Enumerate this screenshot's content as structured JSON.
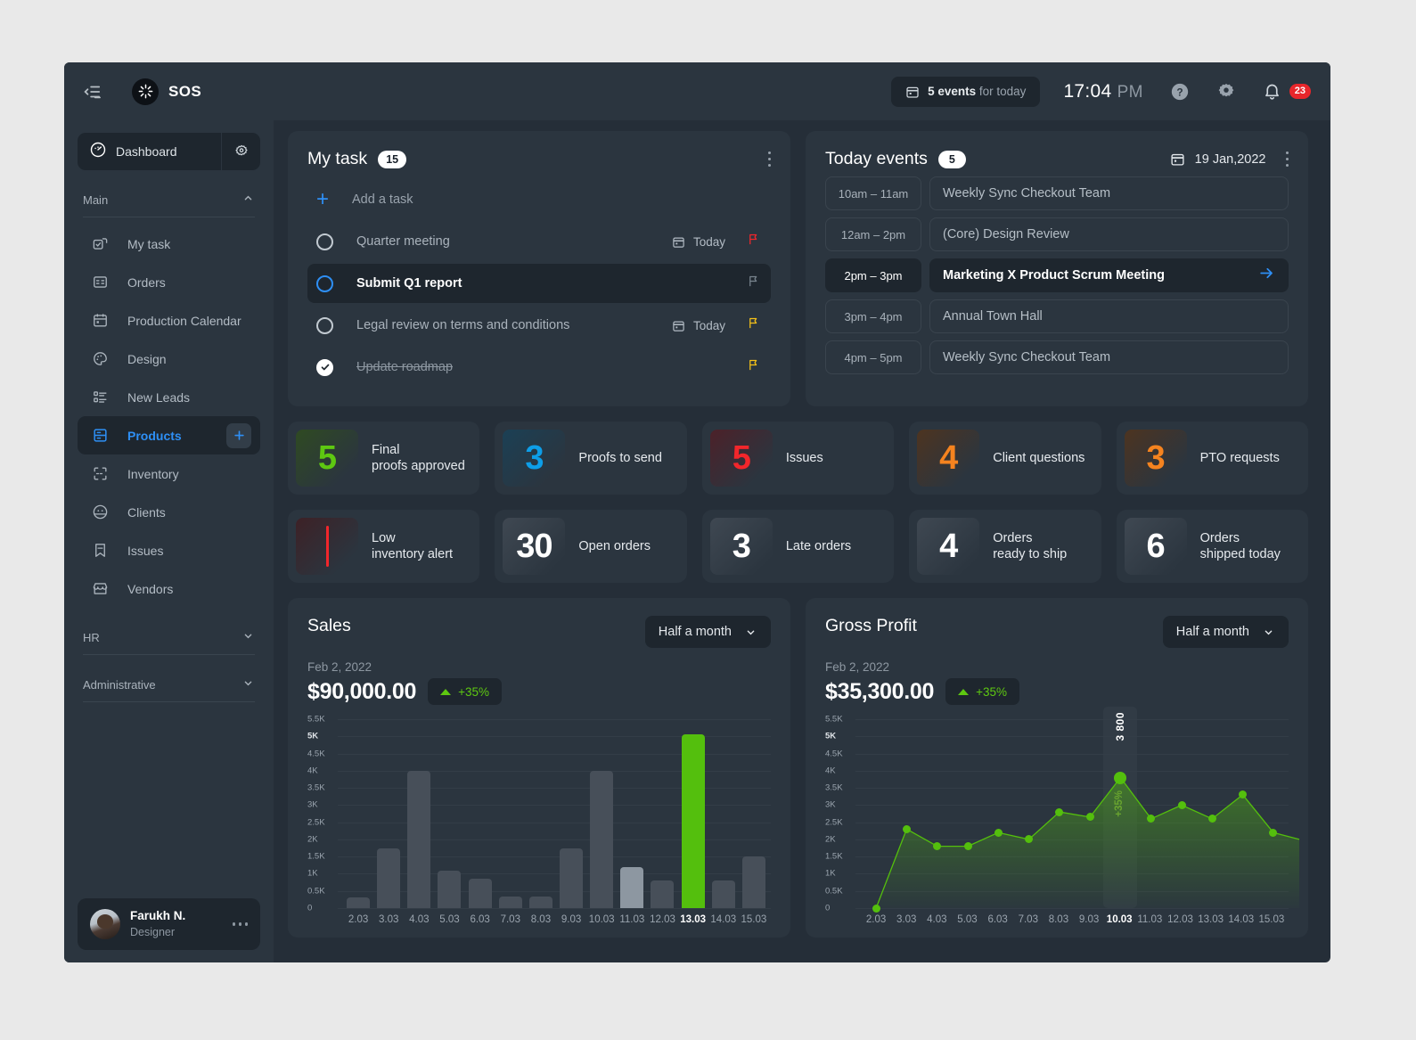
{
  "topbar": {
    "collapse_icon": "collapse-sidebar-icon",
    "brand_name": "SOS",
    "events_count": "5 events",
    "events_suffix": " for today",
    "time": "17:04",
    "ampm": "PM",
    "help_icon": "help-icon",
    "settings_icon": "gear-icon",
    "bell_icon": "bell-icon",
    "notification_count": "23"
  },
  "sidebar": {
    "dashboard_label": "Dashboard",
    "sections": [
      {
        "label": "Main",
        "expanded": true
      },
      {
        "label": "HR",
        "expanded": false
      },
      {
        "label": "Administrative",
        "expanded": false
      }
    ],
    "nav_items": [
      {
        "label": "My task",
        "icon": "task-check-icon",
        "active": false
      },
      {
        "label": "Orders",
        "icon": "orders-card-icon",
        "active": false
      },
      {
        "label": "Production Calendar",
        "icon": "calendar-icon",
        "active": false
      },
      {
        "label": "Design",
        "icon": "palette-icon",
        "active": false
      },
      {
        "label": "New Leads",
        "icon": "list-icon",
        "active": false
      },
      {
        "label": "Products",
        "icon": "product-box-icon",
        "active": true
      },
      {
        "label": "Inventory",
        "icon": "scan-frame-icon",
        "active": false
      },
      {
        "label": "Clients",
        "icon": "client-face-icon",
        "active": false
      },
      {
        "label": "Issues",
        "icon": "bookmark-icon",
        "active": false
      },
      {
        "label": "Vendors",
        "icon": "store-icon",
        "active": false
      }
    ],
    "add_product_label": "+",
    "profile": {
      "name": "Farukh N.",
      "role": "Designer"
    }
  },
  "my_task": {
    "title": "My task",
    "count": "15",
    "add_label": "Add a task",
    "tasks": [
      {
        "label": "Quarter meeting",
        "state": "open",
        "due": "Today",
        "flag": "#f2262b"
      },
      {
        "label": "Submit Q1 report",
        "state": "selected",
        "due": "",
        "flag": "#78838d"
      },
      {
        "label": "Legal review on terms and conditions",
        "state": "open",
        "due": "Today",
        "flag": "#f5c118"
      },
      {
        "label": "Update roadmap",
        "state": "done",
        "due": "",
        "flag": "#f5c118"
      }
    ]
  },
  "today_events": {
    "title": "Today events",
    "count": "5",
    "date": "19 Jan,2022",
    "events": [
      {
        "time": "10am – 11am",
        "name": "Weekly Sync Checkout Team",
        "selected": false
      },
      {
        "time": "12am – 2pm",
        "name": "(Core) Design Review",
        "selected": false
      },
      {
        "time": "2pm – 3pm",
        "name": "Marketing X Product Scrum Meeting",
        "selected": true
      },
      {
        "time": "3pm – 4pm",
        "name": "Annual Town Hall",
        "selected": false
      },
      {
        "time": "4pm – 5pm",
        "name": "Weekly Sync Checkout Team",
        "selected": false
      }
    ]
  },
  "stats": [
    {
      "value": "5",
      "label": "Final\nproofs approved",
      "color": "#5ec811",
      "tint": "#2f4a22",
      "bar": false
    },
    {
      "value": "3",
      "label": "Proofs to send",
      "color": "#0d9ee8",
      "tint": "#1b4055",
      "bar": false
    },
    {
      "value": "5",
      "label": "Issues",
      "color": "#f2262b",
      "tint": "#4c2129",
      "bar": false
    },
    {
      "value": "4",
      "label": "Client questions",
      "color": "#f5831f",
      "tint": "#4d3420",
      "bar": false
    },
    {
      "value": "3",
      "label": "PTO requests",
      "color": "#f5831f",
      "tint": "#4d3420",
      "bar": false
    },
    {
      "value": "",
      "label": "Low\ninventory alert",
      "color": "#f2262b",
      "tint": "#3d2126",
      "bar": true
    },
    {
      "value": "30",
      "label": "Open orders",
      "color": "#ffffff",
      "tint": "#3b444e",
      "bar": false
    },
    {
      "value": "3",
      "label": "Late orders",
      "color": "#ffffff",
      "tint": "#3b444e",
      "bar": false
    },
    {
      "value": "4",
      "label": "Orders\nready to ship",
      "color": "#ffffff",
      "tint": "#3b444e",
      "bar": false
    },
    {
      "value": "6",
      "label": "Orders\nshipped today",
      "color": "#ffffff",
      "tint": "#3b444e",
      "bar": false
    }
  ],
  "sales": {
    "title": "Sales",
    "range": "Half a month",
    "date": "Feb 2, 2022",
    "amount": "$90,000.00",
    "delta": "+35%"
  },
  "gross_profit": {
    "title": "Gross Profit",
    "range": "Half a month",
    "date": "Feb 2, 2022",
    "amount": "$35,300.00",
    "delta": "+35%"
  },
  "chart_data": [
    {
      "type": "bar",
      "title": "Sales",
      "xlabel": "",
      "ylabel": "",
      "ylim": [
        0,
        5500
      ],
      "grid": true,
      "ytick_labels": [
        "0",
        "0.5K",
        "1K",
        "1.5K",
        "2K",
        "2.5K",
        "3K",
        "3.5K",
        "4K",
        "4.5K",
        "5K",
        "5.5K"
      ],
      "ytick_values": [
        0,
        500,
        1000,
        1500,
        2000,
        2500,
        3000,
        3500,
        4000,
        4500,
        5000,
        5500
      ],
      "categories": [
        "2.03",
        "3.03",
        "4.03",
        "5.03",
        "6.03",
        "7.03",
        "8.03",
        "9.03",
        "10.03",
        "11.03",
        "12.03",
        "13.03",
        "14.03",
        "15.03"
      ],
      "values": [
        300,
        1750,
        4000,
        1100,
        850,
        350,
        350,
        1750,
        4000,
        1200,
        800,
        5050,
        800,
        1500
      ],
      "highlight_index": 11,
      "highlight_color": "#54bf0d",
      "secondary_index": 9,
      "secondary_color": "#8d97a1",
      "bar_color": "#474f59"
    },
    {
      "type": "line",
      "title": "Gross Profit",
      "xlabel": "",
      "ylabel": "",
      "ylim": [
        0,
        5500
      ],
      "grid": true,
      "ytick_labels": [
        "0",
        "0.5K",
        "1K",
        "1.5K",
        "2K",
        "2.5K",
        "3K",
        "3.5K",
        "4K",
        "4.5K",
        "5K",
        "5.5K"
      ],
      "ytick_values": [
        0,
        500,
        1000,
        1500,
        2000,
        2500,
        3000,
        3500,
        4000,
        4500,
        5000,
        5500
      ],
      "categories": [
        "2.03",
        "3.03",
        "4.03",
        "5.03",
        "6.03",
        "7.03",
        "8.03",
        "9.03",
        "10.03",
        "11.03",
        "12.03",
        "13.03",
        "14.03",
        "15.03"
      ],
      "values": [
        0,
        2300,
        1800,
        1800,
        2200,
        2000,
        2800,
        2650,
        3800,
        2600,
        3000,
        2600,
        3300,
        2200
      ],
      "highlight_index": 8,
      "point_label": "3 800",
      "pct_label": "+35%",
      "line_color": "#54bf0d",
      "area_fill": "rgba(84,191,13,0.25)"
    }
  ]
}
